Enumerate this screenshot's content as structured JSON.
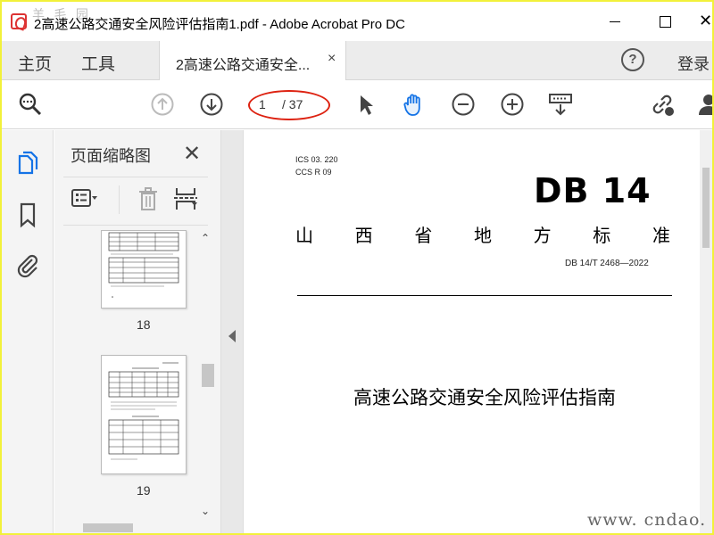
{
  "window": {
    "title": "2高速公路交通安全风险评估指南1.pdf - Adobe Acrobat Pro DC",
    "watermark_top": "羊 毛 园",
    "close_glyph": "✕"
  },
  "menu": {
    "home": "主页",
    "tools": "工具",
    "doc_tab": "2高速公路交通安全...",
    "doc_tab_close": "×",
    "help": "?",
    "sign_in": "登录"
  },
  "toolbar": {
    "page_current": "1",
    "page_total": "/ 37",
    "icons": [
      "search-zoom-icon",
      "arrow-up-icon",
      "arrow-down-icon",
      "select-cursor-icon",
      "hand-icon",
      "zoom-out-icon",
      "zoom-in-icon",
      "marquee-zoom-icon",
      "share-link-icon",
      "user-icon"
    ],
    "highlight_color": "#d22211"
  },
  "rail": {
    "icons": [
      "page-thumbnails-icon",
      "bookmark-icon",
      "attachment-icon"
    ],
    "accent": "#1473e6"
  },
  "thumbnails": {
    "title": "页面缩略图",
    "close": "✕",
    "pages": [
      {
        "number": "18"
      },
      {
        "number": "19"
      }
    ],
    "scroll_up": "⌃",
    "scroll_down": "⌄"
  },
  "document": {
    "ics": "ICS  03. 220",
    "ccs": "CCS  R  09",
    "logo": "DB 14",
    "province_chars": [
      "山",
      "西",
      "省",
      "地",
      "方",
      "标",
      "准"
    ],
    "std_code": "DB 14/T  2468—2022",
    "title": "高速公路交通安全风险评估指南"
  },
  "footer_watermark": "www. cndao. com",
  "colors": {
    "frame_border": "#f2f13a",
    "tab_bg": "#ececec",
    "panel_bg": "#f4f4f4"
  }
}
